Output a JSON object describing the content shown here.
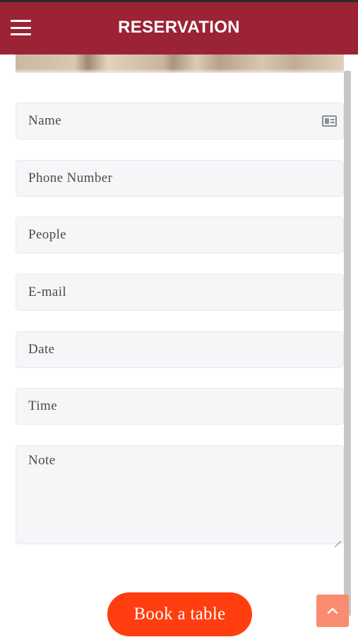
{
  "header": {
    "title": "RESERVATION",
    "menu_icon": "hamburger-menu-icon",
    "background_color": "#9b2335"
  },
  "form": {
    "fields": [
      {
        "label": "Name",
        "icon": "id-card-icon"
      },
      {
        "label": "Phone Number"
      },
      {
        "label": "People"
      },
      {
        "label": "E-mail"
      },
      {
        "label": "Date"
      },
      {
        "label": "Time"
      },
      {
        "label": "Note"
      }
    ],
    "submit_label": "Book a table",
    "submit_color": "#ff3d0f"
  },
  "scroll_top": {
    "icon": "chevron-up-icon",
    "color": "#f98b70"
  }
}
